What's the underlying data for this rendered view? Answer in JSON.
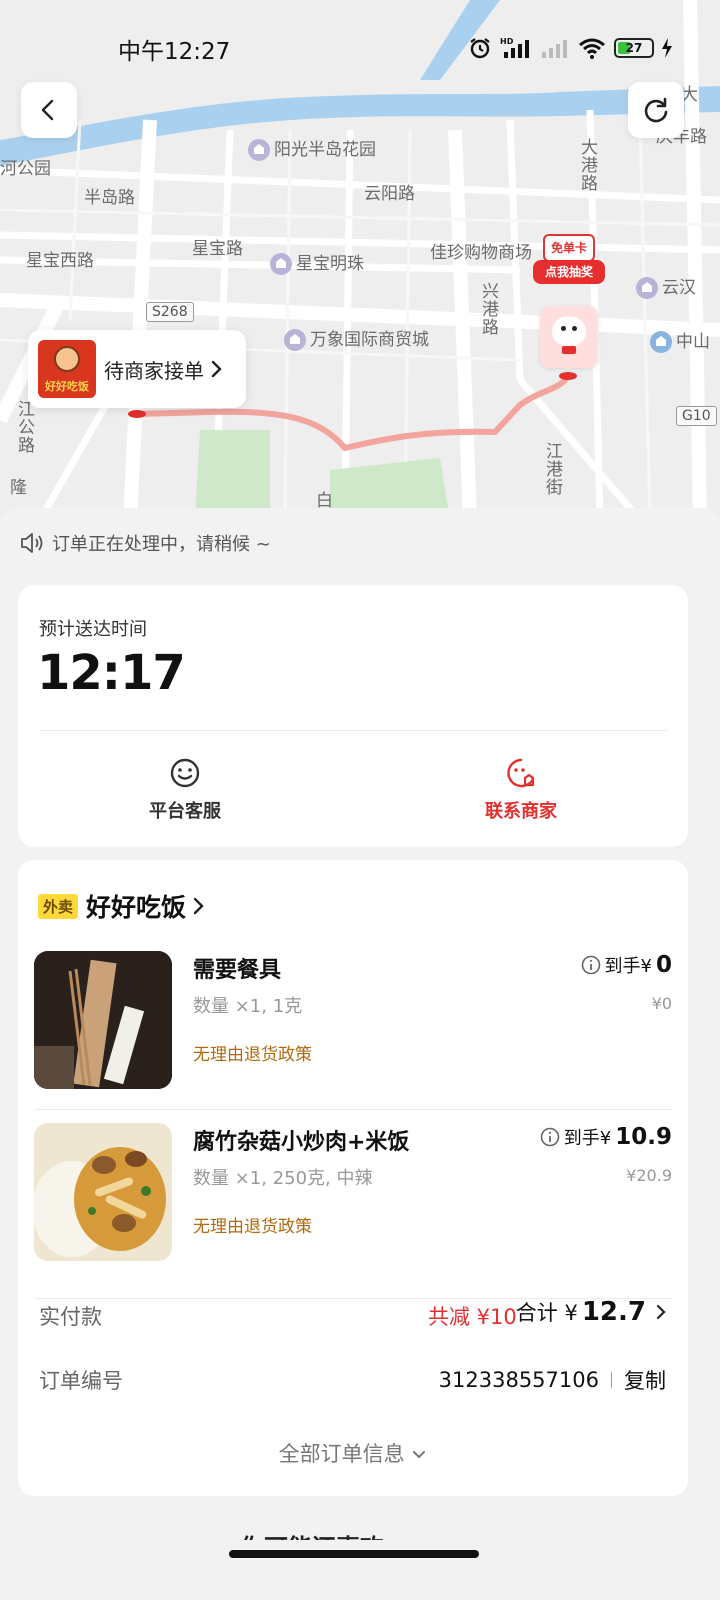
{
  "status_bar": {
    "time": "中午12:27",
    "hd_label": "HD",
    "battery": "27"
  },
  "map": {
    "labels": {
      "lake": "河公园",
      "sunshine_garden": "阳光半岛花园",
      "peninsula_road": "半岛路",
      "yunyang_road": "云阳路",
      "dagang_road": "大港路",
      "xingbao_west": "星宝西路",
      "xingbao_road": "星宝路",
      "xingbao_pearl": "星宝明珠",
      "jiazhen_mall": "佳珍购物商场",
      "yunhan": "云汉",
      "s268": "S268",
      "xinggang_road": "兴港路",
      "wanxiang": "万象国际商贸城",
      "zhongshan": "中山",
      "g10": "G10",
      "jiangang_street": "江港街",
      "gonglu": "江公路",
      "baishi": "白",
      "longfu": "隆",
      "top_right": "口大",
      "top_right_road": "庆丰路"
    },
    "merchant_status": "待商家接单",
    "merchant_logo_text": "好好吃饭",
    "promo_top": "免单卡",
    "promo_bottom": "点我抽奖"
  },
  "notice": "订单正在处理中，请稍候 ~",
  "eta": {
    "label": "预计送达时间",
    "time": "12:17",
    "service_label": "平台客服",
    "contact_label": "联系商家"
  },
  "colors": {
    "accent_red": "#e3302f",
    "route": "#f2a49d",
    "policy": "#b06a10"
  },
  "order": {
    "tag": "外卖",
    "shop_name": "好好吃饭",
    "items": [
      {
        "name": "需要餐具",
        "spec": "数量 ×1, 1克",
        "policy": "无理由退货政策",
        "price_prefix": "到手¥",
        "price": "0",
        "original": "¥0"
      },
      {
        "name": "腐竹杂菇小炒肉+米饭",
        "spec": "数量 ×1, 250克, 中辣",
        "policy": "无理由退货政策",
        "price_prefix": "到手¥",
        "price": "10.9",
        "original": "¥20.9"
      }
    ],
    "paid_label": "实付款",
    "discount": "共减 ¥10",
    "total_prefix": "合计 ¥",
    "total": "12.7",
    "order_no_label": "订单编号",
    "order_no": "312338557106",
    "copy_label": "复制",
    "all_info": "全部订单信息"
  },
  "more_peek": "你可能还喜欢"
}
